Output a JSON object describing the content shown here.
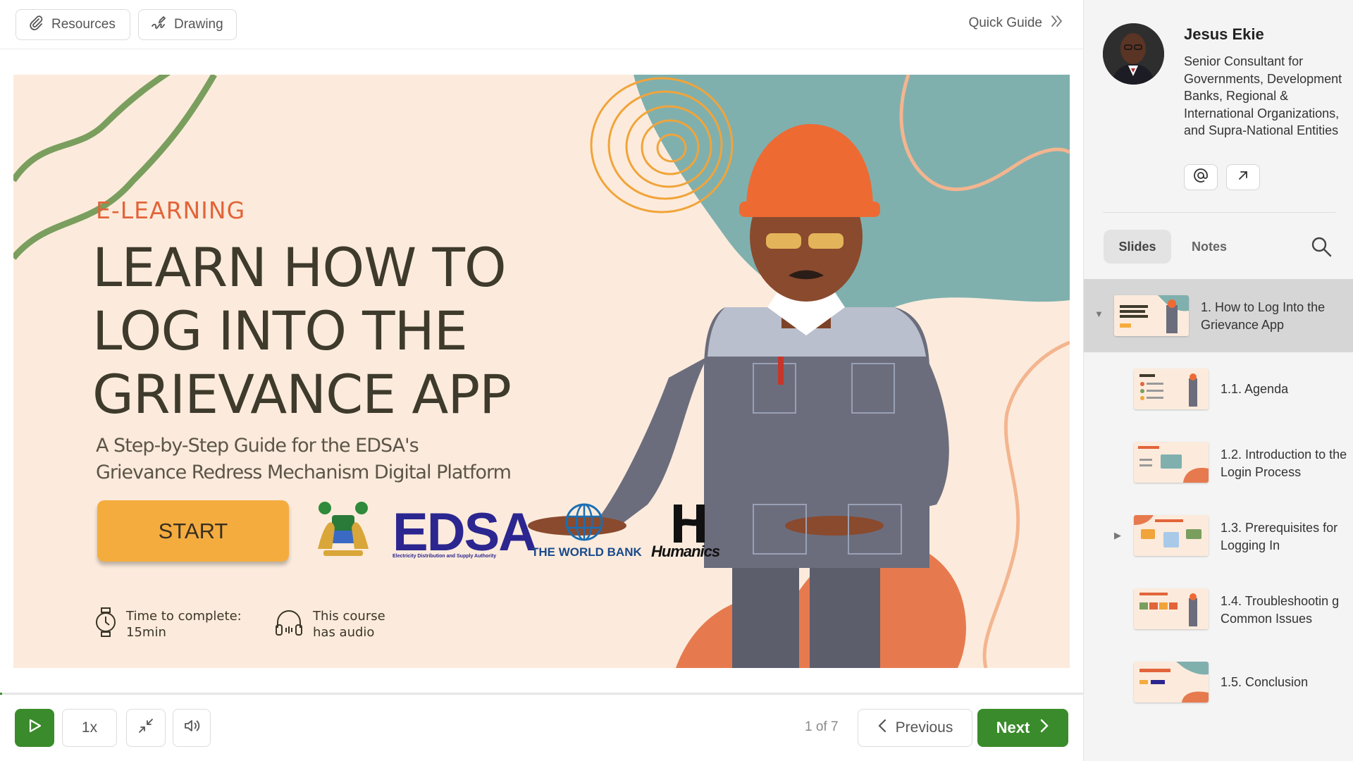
{
  "toolbar": {
    "resources_label": "Resources",
    "drawing_label": "Drawing",
    "quick_guide_label": "Quick Guide"
  },
  "slide": {
    "eyebrow": "E-LEARNING",
    "title_lines": [
      "LEARN HOW TO",
      "LOG INTO THE",
      "GRIEVANCE APP"
    ],
    "subtitle_lines": [
      "A Step-by-Step Guide for the EDSA's",
      "Grievance Redress Mechanism Digital Platform"
    ],
    "start_label": "START",
    "logos": {
      "edsa": "EDSA",
      "edsa_sub": "Electricity Distribution and Supply Authority",
      "world_bank": "THE WORLD BANK",
      "humanics": "Humanics"
    },
    "time_label": "Time to complete:",
    "time_value": "15min",
    "audio_line1": "This course",
    "audio_line2": "has audio"
  },
  "player": {
    "speed_label": "1x",
    "counter": "1 of 7",
    "previous_label": "Previous",
    "next_label": "Next",
    "progress_fraction": 0.002
  },
  "presenter": {
    "name": "Jesus Ekie",
    "bio": "Senior Consultant for Governments, Development Banks, Regional & International Organizations, and Supra-National Entities"
  },
  "tabs": {
    "slides": "Slides",
    "notes": "Notes"
  },
  "outline": [
    {
      "label": "1. How to Log Into the Grievance App",
      "active": true
    },
    {
      "label": "1.1. Agenda"
    },
    {
      "label": "1.2. Introduction to the Login Process"
    },
    {
      "label": "1.3. Prerequisites for Logging In"
    },
    {
      "label": "1.4. Troubleshootin g Common Issues"
    },
    {
      "label": "1.5. Conclusion"
    }
  ],
  "colors": {
    "accent_green": "#3a8b2b",
    "start_orange": "#f5ac3f",
    "slide_bg": "#fcebdc",
    "title_dark": "#3e3a2c",
    "eyebrow_orange": "#e2643a"
  },
  "icons": {
    "resources": "paperclip-icon",
    "drawing": "scribble-icon",
    "quick_guide": "double-chevron-right-icon",
    "play": "play-icon",
    "collapse": "collapse-arrows-icon",
    "volume": "volume-icon",
    "email": "at-sign-icon",
    "external": "arrow-up-right-icon",
    "search": "search-icon",
    "time": "stopwatch-icon",
    "audio": "headphones-icon"
  }
}
